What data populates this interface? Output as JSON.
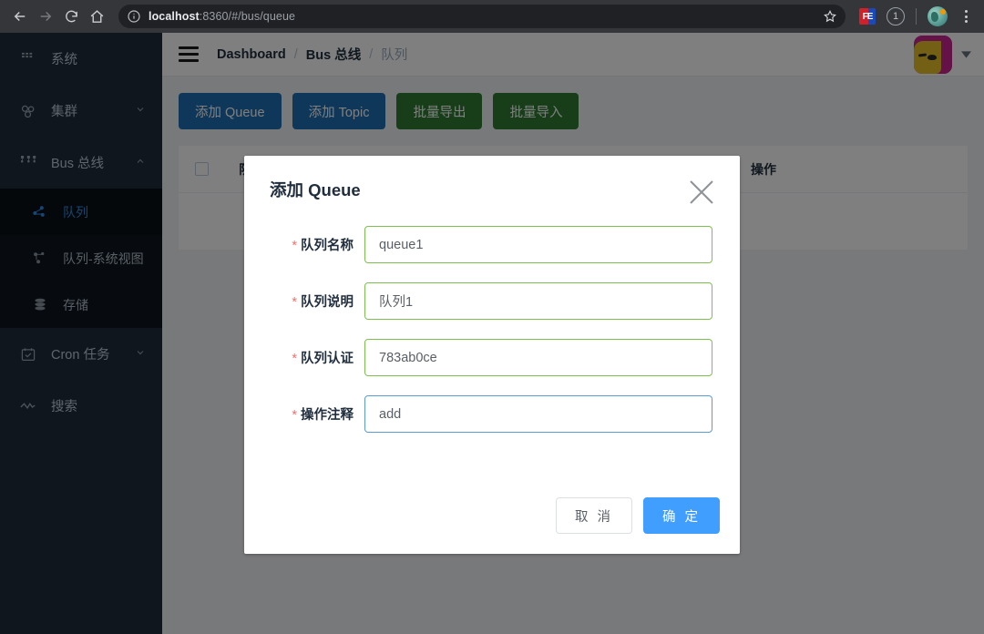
{
  "browser": {
    "back_icon": "arrow-left-icon",
    "forward_icon": "arrow-right-icon",
    "reload_icon": "reload-icon",
    "home_icon": "home-icon",
    "info_icon": "info-circle-icon",
    "url_host": "localhost",
    "url_rest": ":8360/#/bus/queue",
    "url_full": "localhost:8360/#/bus/queue",
    "star_icon": "star-icon",
    "extension_label": "FE",
    "extension_icon": "fe-extension-icon",
    "notification_badge": "1",
    "profile_icon": "profile-avatar-icon",
    "menu_icon": "kebab-menu-icon"
  },
  "sidebar": {
    "groups": [
      {
        "label": "系统",
        "icon": "grid-apps-icon",
        "arrow": "",
        "children": []
      },
      {
        "label": "集群",
        "icon": "cluster-nodes-icon",
        "arrow": "chevron-down-icon",
        "children": []
      },
      {
        "label": "Bus 总线",
        "icon": "bus-topology-icon",
        "arrow": "chevron-up-icon",
        "children": [
          {
            "label": "队列",
            "icon": "queue-node-icon",
            "active": true
          },
          {
            "label": "队列-系统视图",
            "icon": "queue-tree-icon",
            "active": false
          },
          {
            "label": "存储",
            "icon": "database-icon",
            "active": false
          }
        ]
      },
      {
        "label": "Cron 任务",
        "icon": "calendar-check-icon",
        "arrow": "chevron-down-icon",
        "children": []
      },
      {
        "label": "搜索",
        "icon": "search-wave-icon",
        "arrow": "",
        "children": []
      }
    ]
  },
  "header": {
    "menu_toggle_icon": "hamburger-icon",
    "breadcrumb": [
      "Dashboard",
      "Bus 总线",
      "队列"
    ],
    "breadcrumb_separator": "/",
    "avatar_icon": "user-avatar",
    "caret_icon": "caret-down-icon"
  },
  "toolbar": {
    "buttons": [
      {
        "label": "添加 Queue",
        "color": "#1f6fb2",
        "style": "blue"
      },
      {
        "label": "添加 Topic",
        "color": "#1f6fb2",
        "style": "blue"
      },
      {
        "label": "批量导出",
        "color": "#2e7d32",
        "style": "green"
      },
      {
        "label": "批量导入",
        "color": "#2e7d32",
        "style": "green"
      }
    ]
  },
  "table": {
    "select_all_checkbox": "unchecked",
    "columns": [
      "队列名称",
      "操作"
    ],
    "rows": []
  },
  "modal": {
    "title": "添加 Queue",
    "close_icon": "close-x-icon",
    "fields": [
      {
        "label": "队列名称",
        "required": "*",
        "value": "queue1",
        "state": "valid"
      },
      {
        "label": "队列说明",
        "required": "*",
        "value": "队列1",
        "state": "valid"
      },
      {
        "label": "队列认证",
        "required": "*",
        "value": "783ab0ce",
        "state": "valid"
      },
      {
        "label": "操作注释",
        "required": "*",
        "value": "add",
        "state": "focused"
      }
    ],
    "cancel_label": "取 消",
    "confirm_label": "确 定"
  },
  "colors": {
    "accent_blue": "#409eff",
    "sidebar_bg": "#1f2d3d",
    "valid_border": "#7ec050",
    "focus_border": "#5b9bd5",
    "required_red": "#f56c6c"
  }
}
